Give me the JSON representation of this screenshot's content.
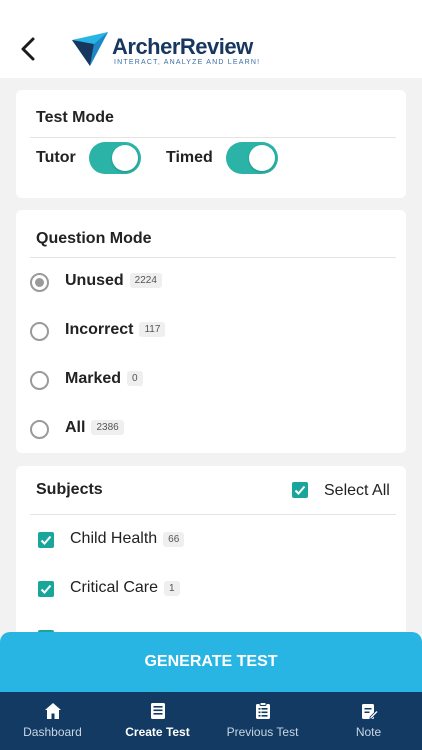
{
  "header": {
    "back_icon": "chevron-left-icon",
    "logo_name": "ArcherReview",
    "logo_tagline": "INTERACT, ANALYZE AND LEARN!",
    "brand_color": "#17375e"
  },
  "test_mode": {
    "title": "Test Mode",
    "tutor": {
      "label": "Tutor",
      "on": true
    },
    "timed": {
      "label": "Timed",
      "on": true
    },
    "toggle_color": "#2ab3a6"
  },
  "question_mode": {
    "title": "Question Mode",
    "options": [
      {
        "label": "Unused",
        "count": "2224",
        "selected": true
      },
      {
        "label": "Incorrect",
        "count": "117",
        "selected": false
      },
      {
        "label": "Marked",
        "count": "0",
        "selected": false
      },
      {
        "label": "All",
        "count": "2386",
        "selected": false
      }
    ]
  },
  "subjects": {
    "title": "Subjects",
    "select_all_label": "Select All",
    "select_all_checked": true,
    "items": [
      {
        "label": "Child Health",
        "count": "66",
        "checked": true
      },
      {
        "label": "Critical Care",
        "count": "1",
        "checked": true
      }
    ],
    "checkbox_color": "#1aa59a"
  },
  "generate_button": {
    "label": "GENERATE TEST",
    "color": "#29b5e3"
  },
  "nav": {
    "background": "#123a62",
    "items": [
      {
        "label": "Dashboard",
        "icon": "home-icon",
        "active": false
      },
      {
        "label": "Create Test",
        "icon": "document-list-icon",
        "active": true
      },
      {
        "label": "Previous Test",
        "icon": "clipboard-list-icon",
        "active": false
      },
      {
        "label": "Note",
        "icon": "note-edit-icon",
        "active": false
      }
    ]
  }
}
